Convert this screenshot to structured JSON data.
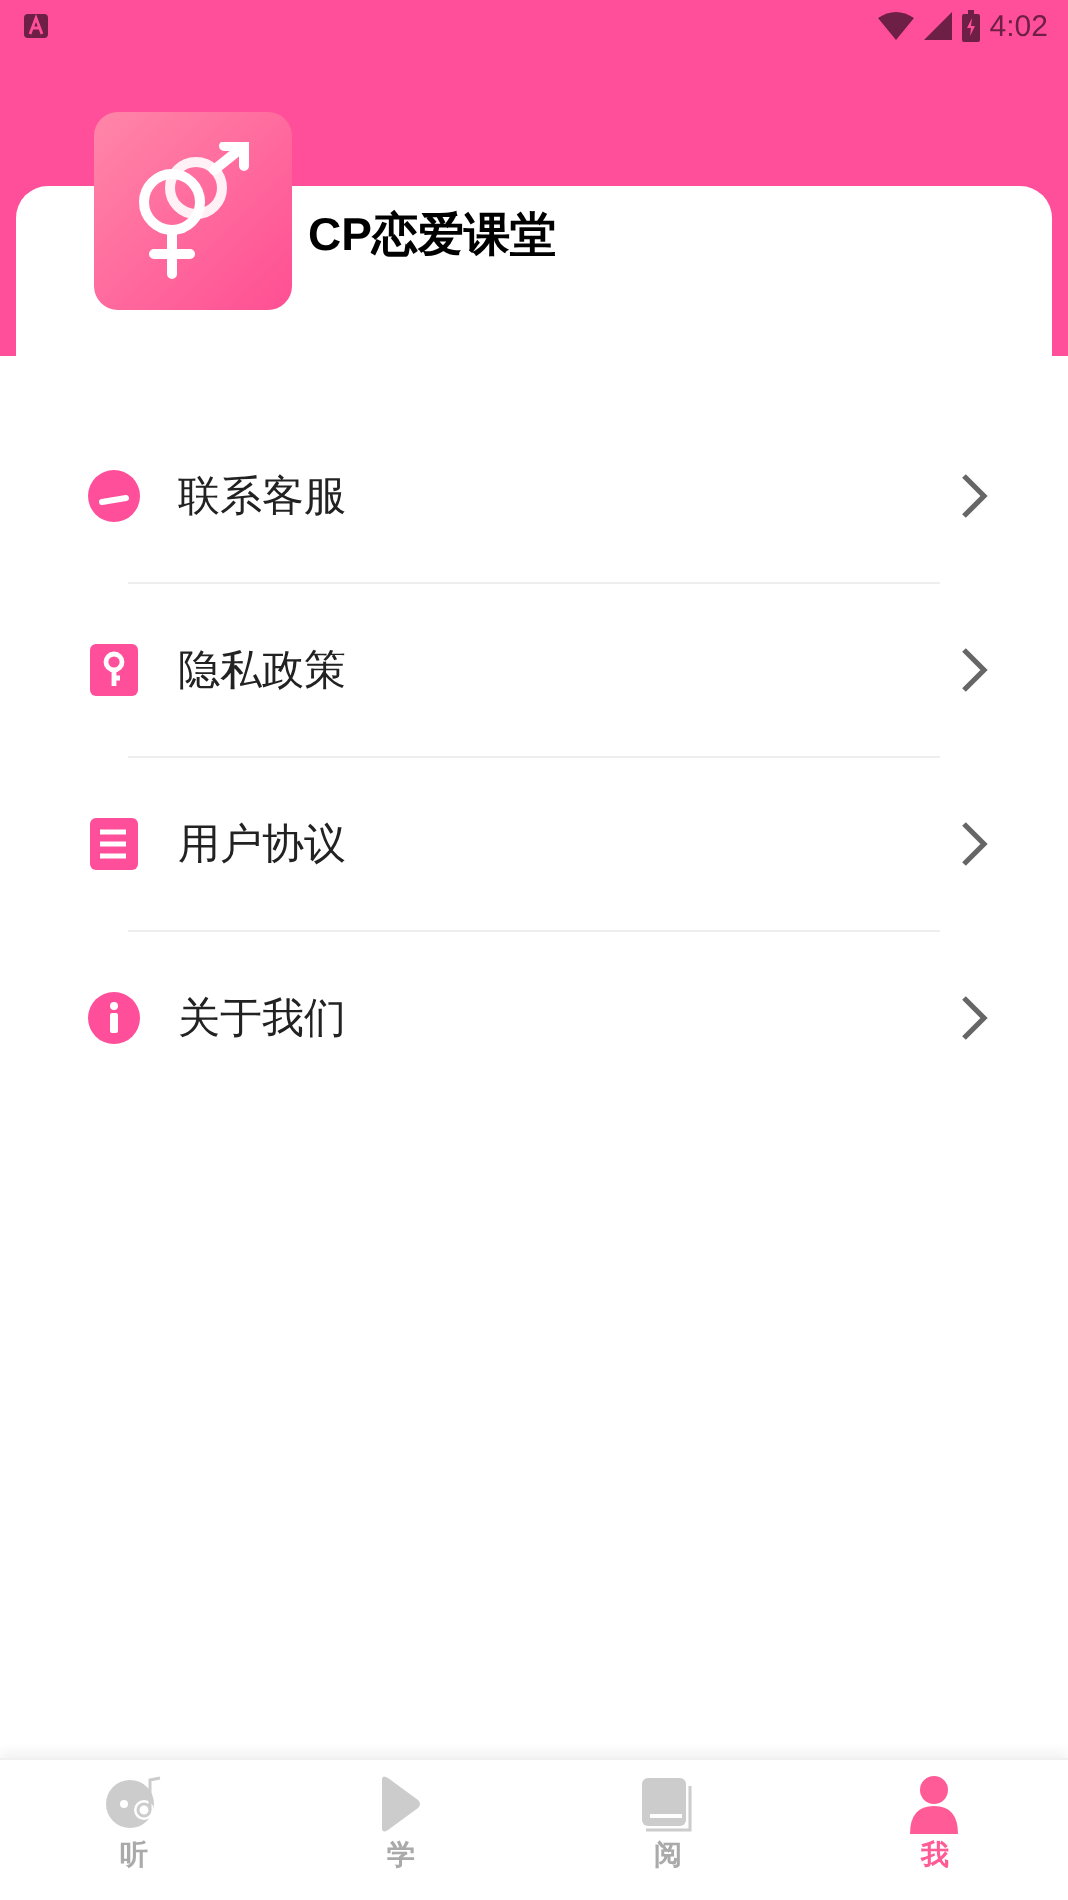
{
  "status_bar": {
    "time": "4:02"
  },
  "app": {
    "name": "CP恋爱课堂"
  },
  "menu": [
    {
      "kind": "service",
      "label": "联系客服"
    },
    {
      "kind": "privacy",
      "label": "隐私政策"
    },
    {
      "kind": "agreement",
      "label": "用户协议"
    },
    {
      "kind": "about",
      "label": "关于我们"
    }
  ],
  "tabs": [
    {
      "kind": "listen",
      "label": "听",
      "selected": false
    },
    {
      "kind": "learn",
      "label": "学",
      "selected": false
    },
    {
      "kind": "read",
      "label": "阅",
      "selected": false
    },
    {
      "kind": "me",
      "label": "我",
      "selected": true
    }
  ]
}
